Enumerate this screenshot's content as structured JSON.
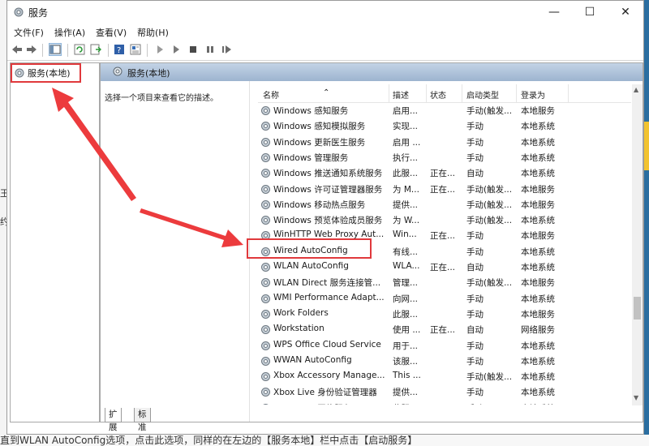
{
  "window": {
    "title": "服务"
  },
  "menu": [
    "文件(F)",
    "操作(A)",
    "查看(V)",
    "帮助(H)"
  ],
  "tree": {
    "item": "服务(本地)"
  },
  "pane": {
    "header": "服务(本地)",
    "description": "选择一个项目来查看它的描述。"
  },
  "columns": [
    "名称",
    "描述",
    "状态",
    "启动类型",
    "登录为"
  ],
  "services": [
    {
      "name": "Windows 感知服务",
      "desc": "启用...",
      "status": "",
      "startup": "手动(触发...",
      "logon": "本地服务"
    },
    {
      "name": "Windows 感知模拟服务",
      "desc": "实现...",
      "status": "",
      "startup": "手动",
      "logon": "本地系统"
    },
    {
      "name": "Windows 更新医生服务",
      "desc": "启用 ...",
      "status": "",
      "startup": "手动",
      "logon": "本地系统"
    },
    {
      "name": "Windows 管理服务",
      "desc": "执行...",
      "status": "",
      "startup": "手动",
      "logon": "本地系统"
    },
    {
      "name": "Windows 推送通知系统服务",
      "desc": "此服...",
      "status": "正在...",
      "startup": "自动",
      "logon": "本地系统"
    },
    {
      "name": "Windows 许可证管理器服务",
      "desc": "为 M...",
      "status": "正在...",
      "startup": "手动(触发...",
      "logon": "本地服务"
    },
    {
      "name": "Windows 移动热点服务",
      "desc": "提供...",
      "status": "",
      "startup": "手动(触发...",
      "logon": "本地服务"
    },
    {
      "name": "Windows 预览体验成员服务",
      "desc": "为 W...",
      "status": "",
      "startup": "手动(触发...",
      "logon": "本地系统"
    },
    {
      "name": "WinHTTP Web Proxy Aut...",
      "desc": "Win...",
      "status": "正在...",
      "startup": "手动",
      "logon": "本地服务"
    },
    {
      "name": "Wired AutoConfig",
      "desc": "有线...",
      "status": "",
      "startup": "手动",
      "logon": "本地系统"
    },
    {
      "name": "WLAN AutoConfig",
      "desc": "WLA...",
      "status": "正在...",
      "startup": "自动",
      "logon": "本地系统"
    },
    {
      "name": "WLAN Direct 服务连接管...",
      "desc": "管理...",
      "status": "",
      "startup": "手动(触发...",
      "logon": "本地服务"
    },
    {
      "name": "WMI Performance Adapt...",
      "desc": "向网...",
      "status": "",
      "startup": "手动",
      "logon": "本地系统"
    },
    {
      "name": "Work Folders",
      "desc": "此服...",
      "status": "",
      "startup": "手动",
      "logon": "本地服务"
    },
    {
      "name": "Workstation",
      "desc": "使用 ...",
      "status": "正在...",
      "startup": "自动",
      "logon": "网络服务"
    },
    {
      "name": "WPS Office Cloud Service",
      "desc": "用于...",
      "status": "",
      "startup": "手动",
      "logon": "本地系统"
    },
    {
      "name": "WWAN AutoConfig",
      "desc": "该服...",
      "status": "",
      "startup": "手动",
      "logon": "本地系统"
    },
    {
      "name": "Xbox Accessory Manage...",
      "desc": "This ...",
      "status": "",
      "startup": "手动(触发...",
      "logon": "本地系统"
    },
    {
      "name": "Xbox Live 身份验证管理器",
      "desc": "提供...",
      "status": "",
      "startup": "手动",
      "logon": "本地系统"
    },
    {
      "name": "Xbox Live 网络服务",
      "desc": "此服...",
      "status": "",
      "startup": "手动",
      "logon": "本地系统"
    }
  ],
  "tabs": [
    "扩展",
    "标准"
  ],
  "left_edge": [
    "王",
    "约"
  ],
  "bottom_text": "直到WLAN AutoConfig选项，点击此选项，同样的在左边的【服务本地】栏中点击【启动服务】",
  "colors": {
    "header_top": "#c3d3e6",
    "header_bottom": "#9db4cf",
    "highlight": "#e0393c"
  }
}
